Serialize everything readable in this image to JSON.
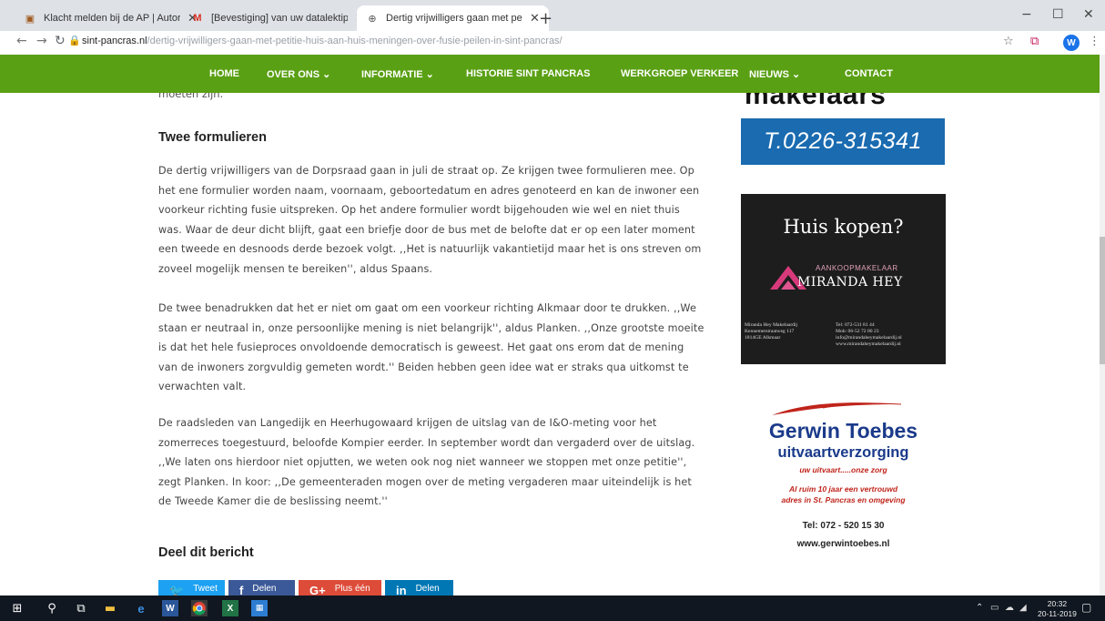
{
  "browser": {
    "tabs": [
      {
        "title": "Klacht melden bij de AP | Autorit",
        "icon": "ap-icon",
        "icon_color": "#a05a20"
      },
      {
        "title": "[Bevestiging] van uw datalektip -",
        "icon": "gmail-icon",
        "icon_color": "#d93025"
      },
      {
        "title": "Dertig vrijwilligers gaan met pet",
        "icon": "globe-icon",
        "icon_color": "#555555"
      }
    ],
    "url_domain": "sint-pancras.nl",
    "url_path": "/dertig-vrijwilligers-gaan-met-petitie-huis-aan-huis-meningen-over-fusie-peilen-in-sint-pancras/",
    "profile_initial": "W"
  },
  "nav": {
    "items": [
      "HOME",
      "OVER ONS ⌄",
      "INFORMATIE ⌄",
      "HISTORIE SINT PANCRAS",
      "WERKGROEP VERKEER",
      "NIEUWS ⌄",
      "CONTACT"
    ],
    "color": "#5aa014"
  },
  "article": {
    "cut_line": "moeten zijn.",
    "heading1": "Twee formulieren",
    "p1": "De dertig vrijwilligers van de Dorpsraad gaan in juli de straat op. Ze krijgen twee formulieren mee. Op het ene formulier worden naam, voornaam, geboortedatum en adres genoteerd en kan de inwoner een voorkeur richting fusie uitspreken. Op het andere formulier wordt bijgehouden wie wel en niet thuis was. Waar de deur dicht blijft, gaat een briefje door de bus met de belofte dat er op een later moment een tweede en desnoods derde bezoek volgt. ,,Het is natuurlijk vakantietijd maar het is ons streven om zoveel mogelijk mensen te bereiken'', aldus Spaans.",
    "p2": "De twee benadrukken dat het er niet om gaat om een voorkeur richting Alkmaar door te drukken. ,,We staan er neutraal in, onze persoonlijke mening is niet belangrijk'', aldus Planken. ,,Onze grootste moeite is dat het hele fusieproces onvoldoende democratisch is geweest. Het gaat ons erom dat de mening van de inwoners zorgvuldig gemeten wordt.'' Beiden hebben geen idee wat er straks qua uitkomst te verwachten valt.",
    "p3": "De raadsleden van Langedijk en Heerhugowaard krijgen de uitslag van de I&O-meting voor het zomerreces toegestuurd, beloofde Kompier eerder. In september wordt dan vergaderd over de uitslag. ,,We laten ons hierdoor niet opjutten, we weten ook nog niet wanneer we stoppen met onze petitie'', zegt Planken. In koor: ,,De gemeenteraden mogen over de meting vergaderen maar uiteindelijk is het de Tweede Kamer die de beslissing neemt.''",
    "heading2": "Deel dit bericht",
    "share": [
      {
        "label": "Tweet",
        "icon": "twitter-icon",
        "glyph": "🐦",
        "color": "#1da1f2"
      },
      {
        "label": "Delen",
        "icon": "facebook-icon",
        "glyph": "f",
        "color": "#3b5998"
      },
      {
        "label": "Plus één",
        "icon": "googleplus-icon",
        "glyph": "G+",
        "color": "#dd4b39"
      },
      {
        "label": "Delen",
        "icon": "linkedin-icon",
        "glyph": "in",
        "color": "#0077b5"
      }
    ]
  },
  "sidebar": {
    "heading_cut": "makelaars",
    "phone": "T.0226-315341",
    "ad1": {
      "title": "Huis kopen?",
      "brand_small": "AANKOOPMAKELAAR",
      "brand_big": "MIRANDA HEY",
      "info_left": "Miranda Hey Makelaardij\nKennemerstraatweg 117\n1814GE Alkmaar",
      "info_right": "Tel: 072-531 81 44\nMob: 06-52 72 80 23\ninfo@mirandaheymakelaardij.nl\nwww.mirandaheymakelaardij.nl"
    },
    "ad2": {
      "name": "Gerwin Toebes",
      "sub": "uitvaartverzorging",
      "tag": "uw uitvaart.....onze zorg",
      "tag2_line1": "Al ruim 10 jaar een vertrouwd",
      "tag2_line2": "adres in St. Pancras en omgeving",
      "tel": "Tel: 072 - 520 15 30",
      "web": "www.gerwintoebes.nl"
    }
  },
  "taskbar": {
    "time": "20:32",
    "date": "20-11-2019"
  }
}
